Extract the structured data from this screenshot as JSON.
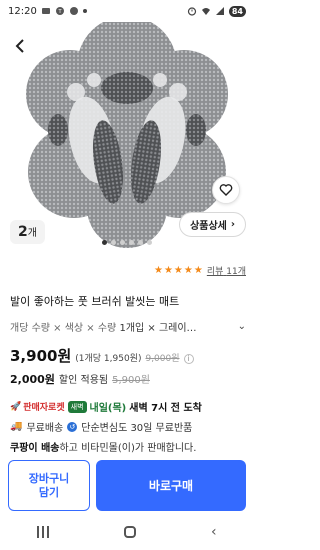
{
  "status_bar": {
    "time": "12:20",
    "battery": "84"
  },
  "product": {
    "image_count": "2",
    "image_count_unit": "개",
    "detail_button": "상품상세",
    "pager": {
      "total": 6,
      "active_index": 0
    },
    "rating": {
      "stars": 5,
      "review_label": "리뷰",
      "review_count": "11개"
    },
    "title": "발이 좋아하는 풋 브러쉬 발씻는 매트",
    "options_prefix": "개당 수량 × 색상 × 수량",
    "options_value": "1개입 × 그레이…"
  },
  "price": {
    "amount": "3,900원",
    "unit_price": "(1개당 1,950원)",
    "original": "9,000원",
    "info_icon": "ⓘ"
  },
  "discount": {
    "amount": "2,000원",
    "label": "할인 적용됨",
    "original": "5,900원"
  },
  "delivery": {
    "seller_tag": "판매자로켓",
    "dawn_badge": "새벽",
    "date": "내일(목)",
    "dawn": "새벽 7시 전 도착"
  },
  "shipping": {
    "free": "무료배송",
    "return": "단순변심도 30일 무료반품"
  },
  "seller": {
    "name": "쿠팡이 배송",
    "text": "하고 비타민몰(이)가 판매합니다."
  },
  "bottom_bar": {
    "cart_line1": "장바구니",
    "cart_line2": "담기",
    "buy": "바로구매"
  },
  "colors": {
    "accent": "#346aff",
    "star": "#f48a1a",
    "delivery_green": "#1f7a3a",
    "seller_red": "#d32f2f"
  }
}
